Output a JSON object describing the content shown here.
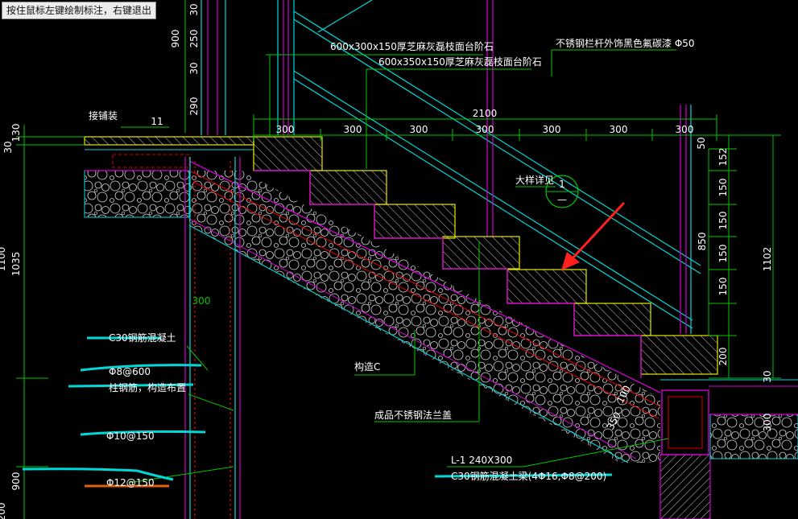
{
  "status_tip": "按住鼠标左键绘制标注，右键退出",
  "colors": {
    "background": "#000000",
    "dim": "#00c800",
    "text_white": "#ffffff",
    "magenta": "#d000d0",
    "cyan": "#00d8d8",
    "yellow": "#e8e800",
    "red": "#e00000",
    "arrow": "#ff2020"
  },
  "notes": {
    "tread_stone": "600x300x150厚芝麻灰磊枝面台阶石",
    "landing_stone": "600x350x150厚芝麻灰磊枝面台阶石",
    "handrail": "不锈钢栏杆外饰黑色氟碳漆 Φ50",
    "paving": "接铺装",
    "detail_ref": "大样详见",
    "detail_no": "1",
    "detail_sub": "—",
    "column": "构造C",
    "railing_base": "成品不锈钢法兰盖",
    "concrete": "C30钢筋混凝土",
    "rebar_1": "Φ8@600",
    "rebar_1_note": "柱钢筋，构造布置",
    "rebar_2": "Φ10@150",
    "rebar_3": "Φ12@150",
    "beam_name": "L-1 240X300",
    "beam_note": "C30钢筋混凝土梁(4Φ16,Φ8@200)"
  },
  "dims": {
    "total_run": "2100",
    "treads": [
      "300",
      "300",
      "300",
      "300",
      "300",
      "300",
      "300"
    ],
    "right_risers": [
      "50",
      "152",
      "150",
      "150",
      "150",
      "150",
      "200"
    ],
    "rail_height": "850",
    "total_rise": "1102",
    "left_top": [
      "30",
      "250",
      "30",
      "290"
    ],
    "left_top_900": "900",
    "left_small": [
      "30",
      "130"
    ],
    "left_big": "1035",
    "left_big_2": "1100",
    "left_bottom": "900",
    "left_bottom_2": "200",
    "level_mark": "11",
    "inner_300": "300",
    "slab_350": "350",
    "slab_100": "100",
    "right_low_30": "30",
    "right_low_300": "300"
  }
}
